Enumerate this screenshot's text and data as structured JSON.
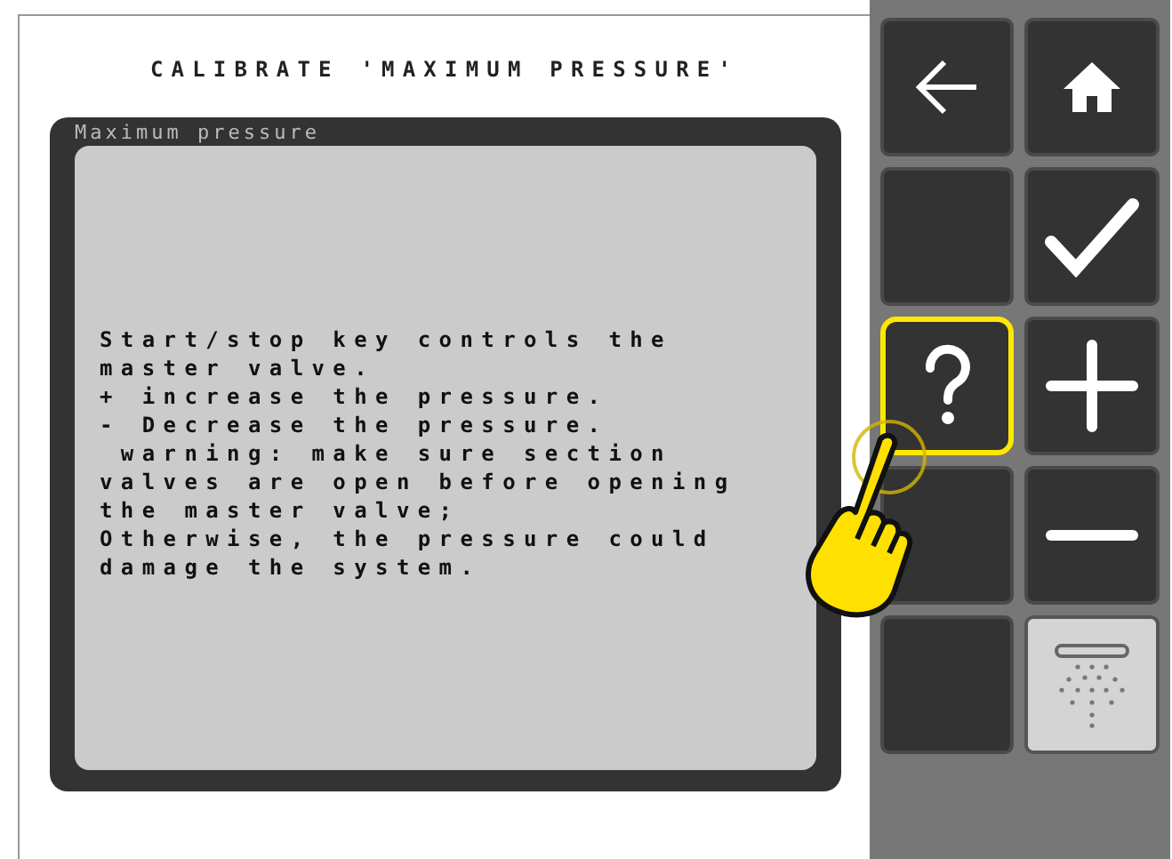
{
  "title": "CALIBRATE 'MAXIMUM PRESSURE'",
  "field_label": "Maximum pressure",
  "help_dialog": {
    "text": "Start/stop key controls the\nmaster valve.\n+ increase the pressure.\n- Decrease the pressure.\n warning: make sure section\nvalves are open before opening\nthe master valve;\nOtherwise, the pressure could\ndamage the system."
  },
  "keys": [
    {
      "kind": "back",
      "highlighted": false,
      "active": false
    },
    {
      "kind": "home",
      "highlighted": false,
      "active": false
    },
    {
      "kind": "blank",
      "highlighted": false,
      "active": false
    },
    {
      "kind": "confirm",
      "highlighted": false,
      "active": false
    },
    {
      "kind": "help",
      "highlighted": true,
      "active": false
    },
    {
      "kind": "plus",
      "highlighted": false,
      "active": false
    },
    {
      "kind": "blank",
      "highlighted": false,
      "active": false
    },
    {
      "kind": "minus",
      "highlighted": false,
      "active": false
    },
    {
      "kind": "blank",
      "highlighted": false,
      "active": false
    },
    {
      "kind": "spray",
      "highlighted": false,
      "active": true
    }
  ]
}
